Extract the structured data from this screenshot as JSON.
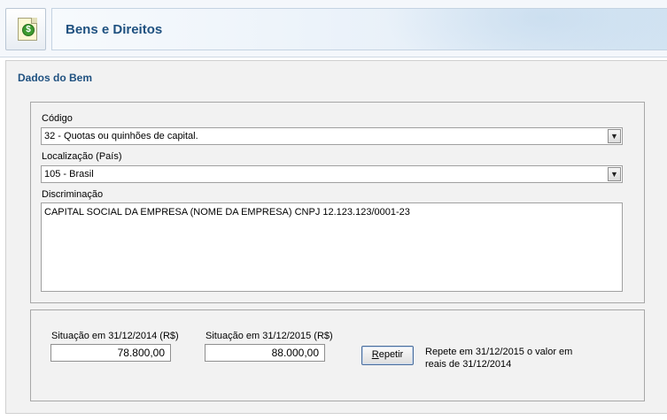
{
  "header": {
    "title": "Bens e Direitos",
    "icon": "money-document-icon",
    "coin_symbol": "$"
  },
  "section": {
    "title": "Dados do Bem"
  },
  "fields": {
    "codigo": {
      "label": "Código",
      "value": "32 - Quotas ou quinhões de capital."
    },
    "localizacao": {
      "label": "Localização (País)",
      "value": "105 - Brasil"
    },
    "discriminacao": {
      "label": "Discriminação",
      "value": "CAPITAL SOCIAL DA EMPRESA (NOME DA EMPRESA) CNPJ 12.123.123/0001-23"
    }
  },
  "situacao": {
    "anterior": {
      "label": "Situação em 31/12/2014 (R$)",
      "value": "78.800,00"
    },
    "atual": {
      "label": "Situação em 31/12/2015 (R$)",
      "value": "88.000,00"
    },
    "repeat_button": {
      "label_first": "R",
      "label_rest": "epetir"
    },
    "repeat_note": "Repete em 31/12/2015 o valor em reais de 31/12/2014"
  },
  "colors": {
    "title": "#1f5180",
    "panel_bg": "#f2f2f2"
  }
}
